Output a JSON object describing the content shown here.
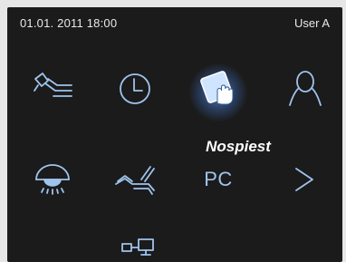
{
  "status": {
    "datetime": "01.01. 2011 18:00",
    "user": "User A"
  },
  "menu": {
    "active_label": "Nospiest",
    "items": [
      {
        "icon": "dental-handpiece-icon"
      },
      {
        "icon": "clock-icon"
      },
      {
        "icon": "touch-screen-icon",
        "active": true
      },
      {
        "icon": "user-icon"
      },
      {
        "icon": "operating-light-icon"
      },
      {
        "icon": "dental-chair-icon"
      },
      {
        "icon": "pc-icon",
        "label": "PC"
      },
      {
        "icon": "chevron-right-icon"
      },
      {
        "icon": "network-connection-icon"
      }
    ]
  },
  "colors": {
    "accent": "#9fc4ec",
    "background": "#1b1b1b",
    "glow": "#6fb0ff"
  }
}
